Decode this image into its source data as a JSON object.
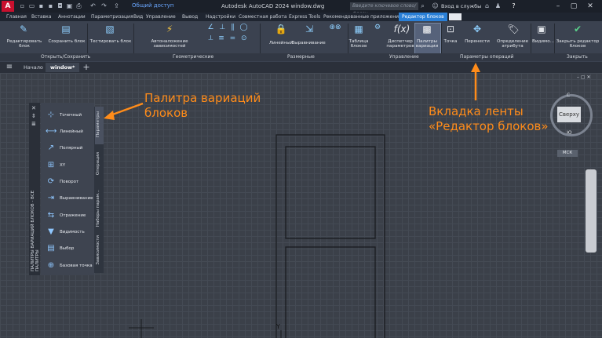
{
  "title_bar": {
    "app_badge": "A",
    "share_label": "Общий доступ",
    "window_title": "Autodesk AutoCAD 2024   window.dwg",
    "search_placeholder": "Введите ключевое слово/фразу",
    "login_label": "Вход в службы"
  },
  "ribbon_tabs": [
    "Главная",
    "Вставка",
    "Аннотации",
    "Параметризация",
    "Вид",
    "Управление",
    "Вывод",
    "Надстройки",
    "Совместная работа",
    "Express Tools",
    "Рекомендованные приложения",
    "Редактор блоков"
  ],
  "ribbon_active_tab": "Редактор блоков",
  "ribbon": {
    "edit_block": "Редактировать блок",
    "save_block": "Сохранить блок",
    "test_block": "Тестировать блок",
    "auto_constraints": "Автоналожение зависимостей",
    "linear": "Линейный",
    "align": "Выравнивание",
    "block_table": "Таблица блоков",
    "param_manager": "Диспетчер параметров",
    "palettes": "Палитры вариации",
    "point": "Точка",
    "move": "Перенести",
    "attr_def": "Определение атрибута",
    "visibility": "Видимо...",
    "close_editor": "Закрыть редактор блоков"
  },
  "panel_labels": {
    "open_save": "Открыть/Сохранить",
    "geometric": "Геометрические",
    "dimensional": "Размерные",
    "manage": "Управление",
    "action_params": "Параметры операций",
    "close": "Закрыть"
  },
  "doc_tabs": {
    "start": "Начало",
    "current": "window*"
  },
  "palette": {
    "side_title": "ПАЛИТРЫ ВАРИАЦИЙ БЛОКОВ - ВСЕ ПАЛИТРЫ",
    "items": [
      "Точечный",
      "Линейный",
      "Полярный",
      "XY",
      "Поворот",
      "Выравнивание",
      "Отражение",
      "Видимость",
      "Выбор",
      "Базовая точка"
    ],
    "tabs": [
      "Параметры",
      "Операции",
      "Наборы парам...",
      "Зависимости"
    ]
  },
  "annotations": {
    "palette_note_line1": "Палитра вариаций",
    "palette_note_line2": "блоков",
    "ribbon_note_line1": "Вкладка ленты",
    "ribbon_note_line2": "«Редактор блоков»"
  },
  "viewcube": {
    "face": "Сверху",
    "north": "С",
    "south": "Ю",
    "ucs": "МСК"
  },
  "ucs_y": "Y",
  "accent": "#ff8c1a",
  "active_tab_color": "#2a7fd6"
}
